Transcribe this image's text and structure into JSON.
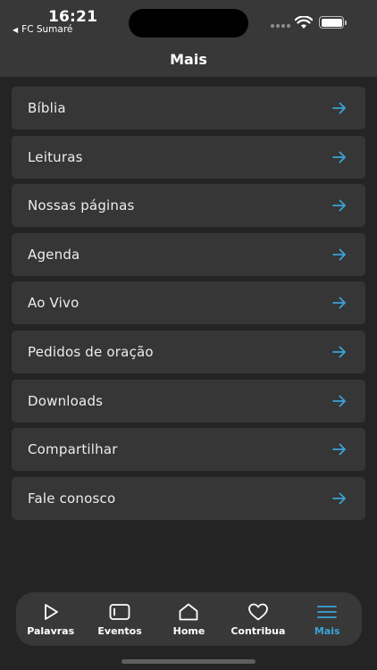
{
  "status": {
    "time": "16:21",
    "back_label": "FC Sumaré"
  },
  "header": {
    "title": "Mais"
  },
  "menu": {
    "items": [
      {
        "label": "Bíblia"
      },
      {
        "label": "Leituras"
      },
      {
        "label": "Nossas páginas"
      },
      {
        "label": "Agenda"
      },
      {
        "label": "Ao Vivo"
      },
      {
        "label": "Pedidos de oração"
      },
      {
        "label": "Downloads"
      },
      {
        "label": "Compartilhar"
      },
      {
        "label": "Fale conosco"
      }
    ],
    "arrow_icon": "arrow-right-icon",
    "arrow_color": "#3aa3d8"
  },
  "tabbar": {
    "tabs": [
      {
        "label": "Palavras",
        "icon": "play-icon"
      },
      {
        "label": "Eventos",
        "icon": "film-icon"
      },
      {
        "label": "Home",
        "icon": "home-icon"
      },
      {
        "label": "Contribua",
        "icon": "heart-icon"
      },
      {
        "label": "Mais",
        "icon": "menu-icon",
        "active": true
      }
    ],
    "active_color": "#3aa3d8"
  }
}
